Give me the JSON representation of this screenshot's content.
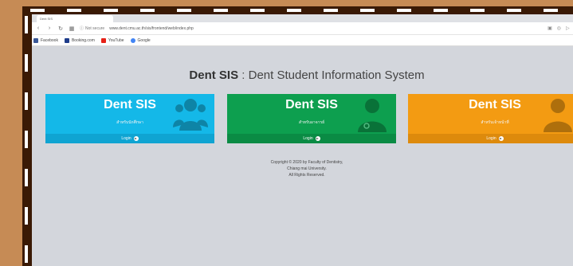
{
  "browser": {
    "tab_title": "Dent SIS",
    "security_label": "Not secure",
    "url": "www.dent.cmu.ac.th/sis/frontend/web/index.php",
    "bookmarks": [
      {
        "label": "Facebook",
        "color": "#3b5998"
      },
      {
        "label": "Booking.com",
        "color": "#1e3c8a"
      },
      {
        "label": "YouTube",
        "color": "#e62117"
      },
      {
        "label": "Google",
        "color": "#4285f4"
      }
    ]
  },
  "page": {
    "title_brand": "Dent SIS",
    "title_separator": ":",
    "title_rest": "Dent Student Information System",
    "cards": [
      {
        "title": "Dent SIS",
        "subtitle": "สำหรับนักศึกษา",
        "footer": "Login",
        "icon": "users-icon",
        "color": "#14b8e8"
      },
      {
        "title": "Dent SIS",
        "subtitle": "สำหรับอาจารย์",
        "footer": "Login",
        "icon": "doctor-icon",
        "color": "#0d9f4f"
      },
      {
        "title": "Dent SIS",
        "subtitle": "สำหรับเจ้าหน้าที่",
        "footer": "Login",
        "icon": "user-icon",
        "color": "#f39b12"
      }
    ],
    "copyright": {
      "line1": "Copyright © 2020 by Faculty of Dentistry,",
      "line2": "Chiang mai University.",
      "line3": "All Rights Reserved."
    }
  }
}
